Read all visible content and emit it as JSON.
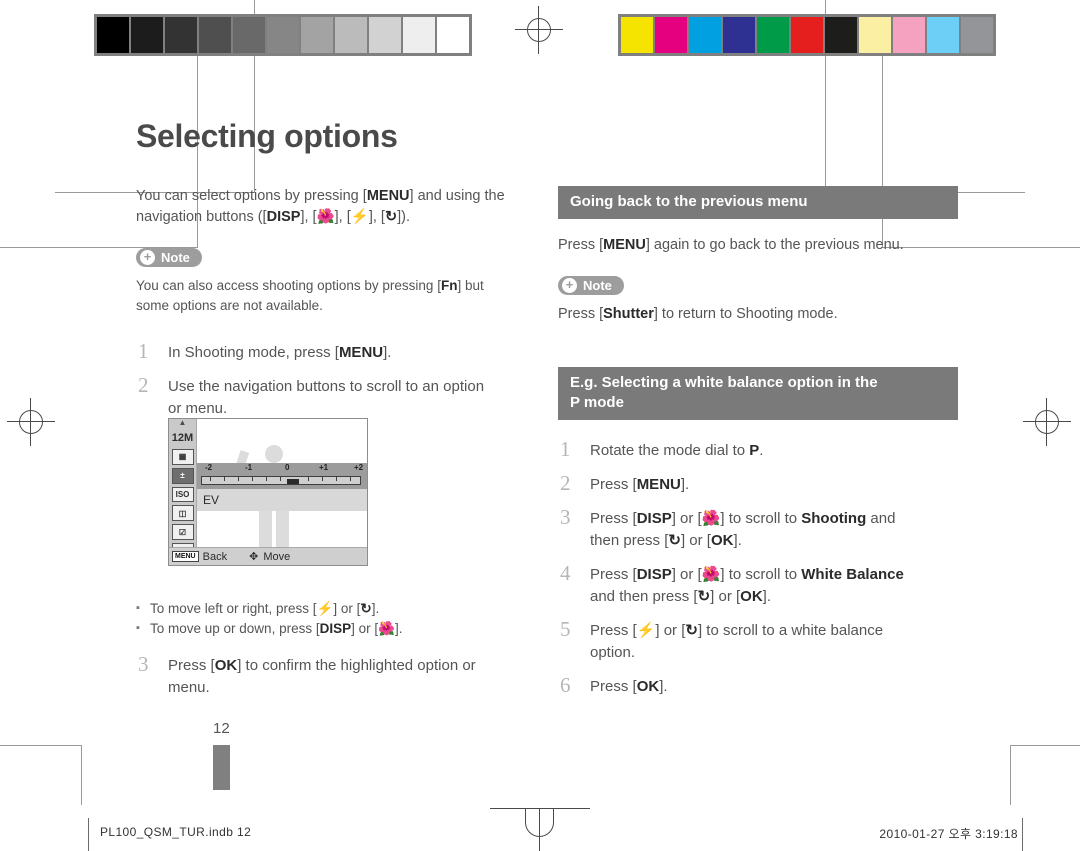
{
  "document": {
    "title": "Selecting options",
    "page_number": "12"
  },
  "left_column": {
    "intro": {
      "line1_pre": "You can select options by pressing [",
      "line1_key": "MENU",
      "line1_post": "] and using the",
      "line2_pre": "navigation buttons ([",
      "line2_keys": [
        "DISP",
        "macro",
        "flash",
        "timer"
      ],
      "line2_post": "])."
    },
    "note": {
      "label": "Note",
      "text_pre": "You can also access shooting options by pressing [",
      "text_key": "Fn",
      "text_post": "] but",
      "text_line2": "some options are not available."
    },
    "steps": [
      {
        "num": "1",
        "text": "In Shooting mode, press [MENU]."
      },
      {
        "num": "2",
        "text": "Use the navigation buttons to scroll to an option or menu."
      },
      {
        "num": "3",
        "text": "Press [OK] to confirm the highlighted option or menu."
      }
    ],
    "bullets": [
      "To move left or right, press [flash] or [timer].",
      "To move up or down, press [DISP] or [macro]."
    ]
  },
  "camera_screen": {
    "resolution_label": "12M",
    "quality_label": "F",
    "iso_label": "ISO",
    "ev_scale": {
      "labels": [
        "-2",
        "-1",
        "0",
        "+1",
        "+2"
      ],
      "current": "0"
    },
    "ev_name": "EV",
    "bottom_bar": {
      "menu_key": "MENU",
      "back_label": "Back",
      "move_label": "Move"
    }
  },
  "right_column": {
    "section1": {
      "heading": "Going back to the previous menu",
      "body_pre": "Press [",
      "body_key": "MENU",
      "body_post": "] again to go back to the previous menu.",
      "note": {
        "label": "Note",
        "text_pre": "Press [",
        "text_key": "Shutter",
        "text_post": "] to return to Shooting mode."
      }
    },
    "section2": {
      "heading_line1": "E.g. Selecting a white balance option in the",
      "heading_line2": "P mode",
      "steps": [
        {
          "num": "1",
          "text": "Rotate the mode dial to P."
        },
        {
          "num": "2",
          "text": "Press [MENU]."
        },
        {
          "num": "3",
          "text": "Press [DISP] or [macro] to scroll to Shooting and then press [timer] or [OK]."
        },
        {
          "num": "4",
          "text": "Press [DISP] or [macro] to scroll to White Balance and then press [timer] or [OK]."
        },
        {
          "num": "5",
          "text": "Press [flash] or [timer] to scroll to a white balance option."
        },
        {
          "num": "6",
          "text": "Press [OK]."
        }
      ]
    }
  },
  "footer": {
    "filename": "PL100_QSM_TUR.indb   12",
    "timestamp": "2010-01-27   오후 3:19:18"
  },
  "print_marks": {
    "grayscale_swatches": [
      "#000000",
      "#1c1c1c",
      "#333333",
      "#4f4f4f",
      "#696969",
      "#868686",
      "#a3a3a3",
      "#bbbbbb",
      "#d2d2d2",
      "#eeeeee",
      "#ffffff"
    ],
    "color_swatches": [
      "#f5e400",
      "#e5007f",
      "#00a0e1",
      "#2e3192",
      "#009b49",
      "#e51e1e",
      "#1d1d1b",
      "#fbefa4",
      "#f4a2c0",
      "#6dcff6",
      "#939598"
    ]
  }
}
